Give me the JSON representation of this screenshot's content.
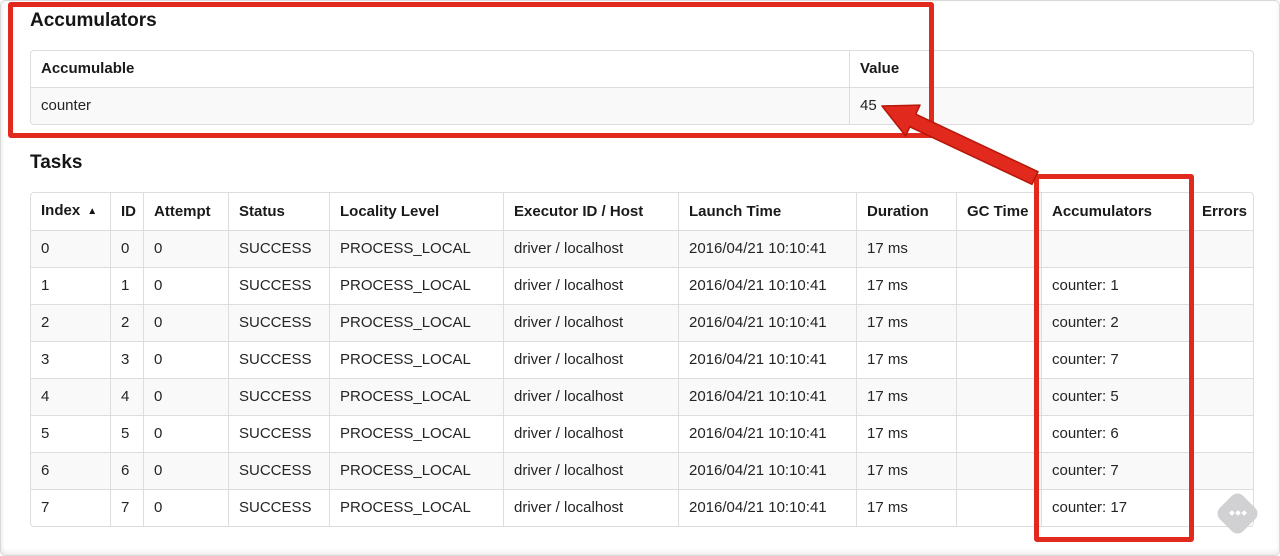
{
  "accumulators": {
    "title": "Accumulators",
    "columns": [
      "Accumulable",
      "Value"
    ],
    "rows": [
      [
        "counter",
        "45"
      ]
    ]
  },
  "tasks": {
    "title": "Tasks",
    "sort_indicator": "▲",
    "columns": [
      "Index",
      "ID",
      "Attempt",
      "Status",
      "Locality Level",
      "Executor ID / Host",
      "Launch Time",
      "Duration",
      "GC Time",
      "Accumulators",
      "Errors"
    ],
    "rows": [
      [
        "0",
        "0",
        "0",
        "SUCCESS",
        "PROCESS_LOCAL",
        "driver / localhost",
        "2016/04/21 10:10:41",
        "17 ms",
        "",
        "",
        ""
      ],
      [
        "1",
        "1",
        "0",
        "SUCCESS",
        "PROCESS_LOCAL",
        "driver / localhost",
        "2016/04/21 10:10:41",
        "17 ms",
        "",
        "counter: 1",
        ""
      ],
      [
        "2",
        "2",
        "0",
        "SUCCESS",
        "PROCESS_LOCAL",
        "driver / localhost",
        "2016/04/21 10:10:41",
        "17 ms",
        "",
        "counter: 2",
        ""
      ],
      [
        "3",
        "3",
        "0",
        "SUCCESS",
        "PROCESS_LOCAL",
        "driver / localhost",
        "2016/04/21 10:10:41",
        "17 ms",
        "",
        "counter: 7",
        ""
      ],
      [
        "4",
        "4",
        "0",
        "SUCCESS",
        "PROCESS_LOCAL",
        "driver / localhost",
        "2016/04/21 10:10:41",
        "17 ms",
        "",
        "counter: 5",
        ""
      ],
      [
        "5",
        "5",
        "0",
        "SUCCESS",
        "PROCESS_LOCAL",
        "driver / localhost",
        "2016/04/21 10:10:41",
        "17 ms",
        "",
        "counter: 6",
        ""
      ],
      [
        "6",
        "6",
        "0",
        "SUCCESS",
        "PROCESS_LOCAL",
        "driver / localhost",
        "2016/04/21 10:10:41",
        "17 ms",
        "",
        "counter: 7",
        ""
      ],
      [
        "7",
        "7",
        "0",
        "SUCCESS",
        "PROCESS_LOCAL",
        "driver / localhost",
        "2016/04/21 10:10:41",
        "17 ms",
        "",
        "counter: 17",
        ""
      ]
    ]
  },
  "annotations": {
    "color": "#e2291d",
    "arrow_outline": "#b51708"
  }
}
